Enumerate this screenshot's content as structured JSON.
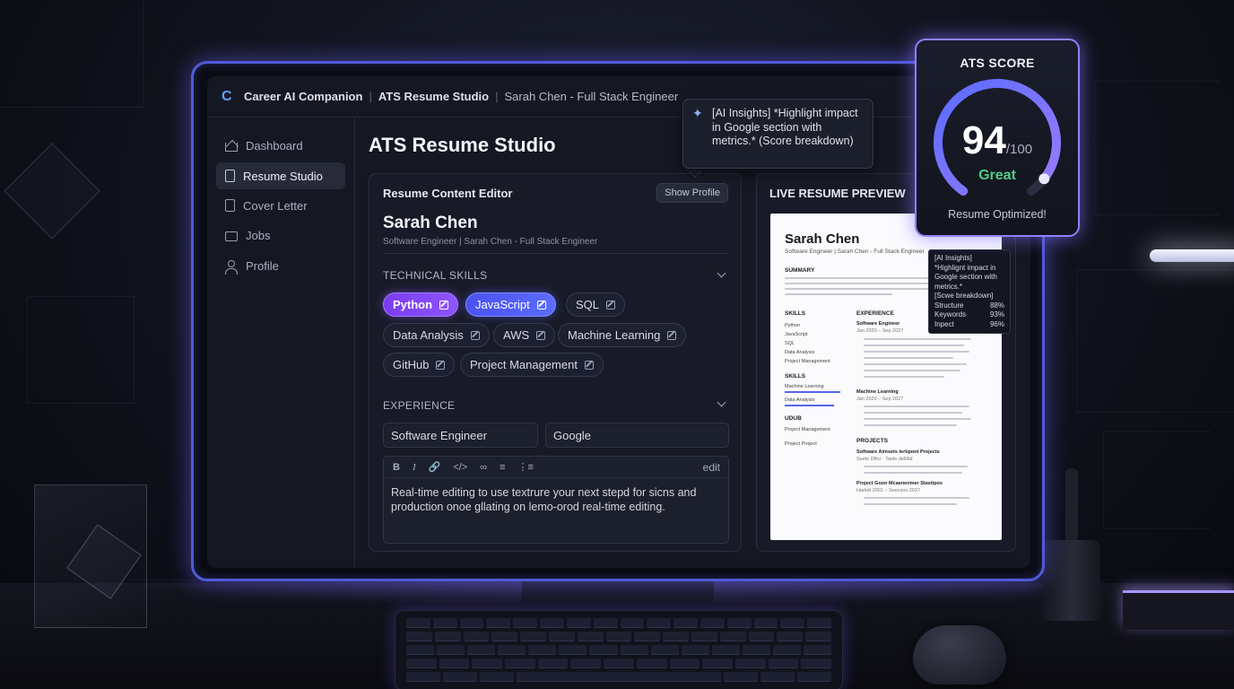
{
  "topbar": {
    "app_name": "Career AI Companion",
    "section": "ATS Resume Studio",
    "context": "Sarah Chen - Full Stack Engineer"
  },
  "sidebar": {
    "items": [
      {
        "label": "Dashboard",
        "icon": "home-icon"
      },
      {
        "label": "Resume Studio",
        "icon": "document-icon",
        "active": true
      },
      {
        "label": "Cover Letter",
        "icon": "document-icon"
      },
      {
        "label": "Jobs",
        "icon": "briefcase-icon"
      },
      {
        "label": "Profile",
        "icon": "user-icon"
      }
    ]
  },
  "main": {
    "title": "ATS Resume Studio"
  },
  "editor": {
    "title": "Resume Content Editor",
    "show_profile": "Show Profile",
    "name": "Sarah Chen",
    "subtitle": "Software Engineer | Sarah Chen - Full Stack Engineer",
    "skills_label": "TECHNICAL SKILLS",
    "skills": [
      "Python",
      "JavaScript",
      "SQL",
      "Data Analysis",
      "AWS",
      "Machine Learning",
      "GitHub",
      "Project Management"
    ],
    "experience_label": "EXPERIENCE",
    "job_title": "Software Engineer",
    "company": "Google",
    "rte_mode": "edit",
    "body": "Real-time editing to use textrure your next stepd for sicns and production onoe gllating on lemo-orod real-time editing."
  },
  "preview": {
    "title": "LIVE RESUME PREVIEW",
    "name": "Sarah Chen",
    "subtitle": "Software Engineer | Sarah Chen - Full Stack Engineer",
    "summary_h": "SUMMARY",
    "skills_h": "SKILLS",
    "experience_h": "EXPERIENCE",
    "skills_list": [
      "Python",
      "JavaScript",
      "SQL",
      "Data Analysis",
      "Project Management"
    ],
    "skills_h2": "SKILLS",
    "skills_list2": [
      "Machine Learning",
      "Data Analysis"
    ],
    "other_h": "UDUB",
    "other_list": [
      "Project Management",
      "Project Project"
    ],
    "job1": "Software Engineer",
    "job1_date": "Jan 2020 – Sep 2027",
    "job2": "Machine Learning",
    "job2_date": "Jan 2020 – Sep 2027",
    "projects_h": "PROJECTS",
    "proj1": "Software Aimsets Ierbpont Projects",
    "proj1_sub": "Seets Dffor · Taole dellifal",
    "proj2": "Project Goon Mcaenenmer Stastipos",
    "proj2_sub": "Harlett 2001 – Seecsos 2027"
  },
  "ai_tip": {
    "text": "[AI Insights] *Highlight impact in Google section with metrics.* (Score breakdown)"
  },
  "mini_tip": {
    "header": "[AI Insights]",
    "body": "*Highlignt impact in Google section with metrics.*",
    "breakdown": "[Scwe breakdown]",
    "rows": [
      {
        "label": "Structure",
        "value": "88%"
      },
      {
        "label": "Keywords",
        "value": "93%"
      },
      {
        "label": "Inpect",
        "value": "96%"
      }
    ]
  },
  "ats": {
    "title": "ATS SCORE",
    "score": "94",
    "out_of": "/100",
    "score_fraction": 0.94,
    "grade": "Great",
    "footer": "Resume Optimized!",
    "grade_color": "#4fd08a",
    "accent_start": "#5b6cff",
    "accent_end": "#9a7bff"
  }
}
